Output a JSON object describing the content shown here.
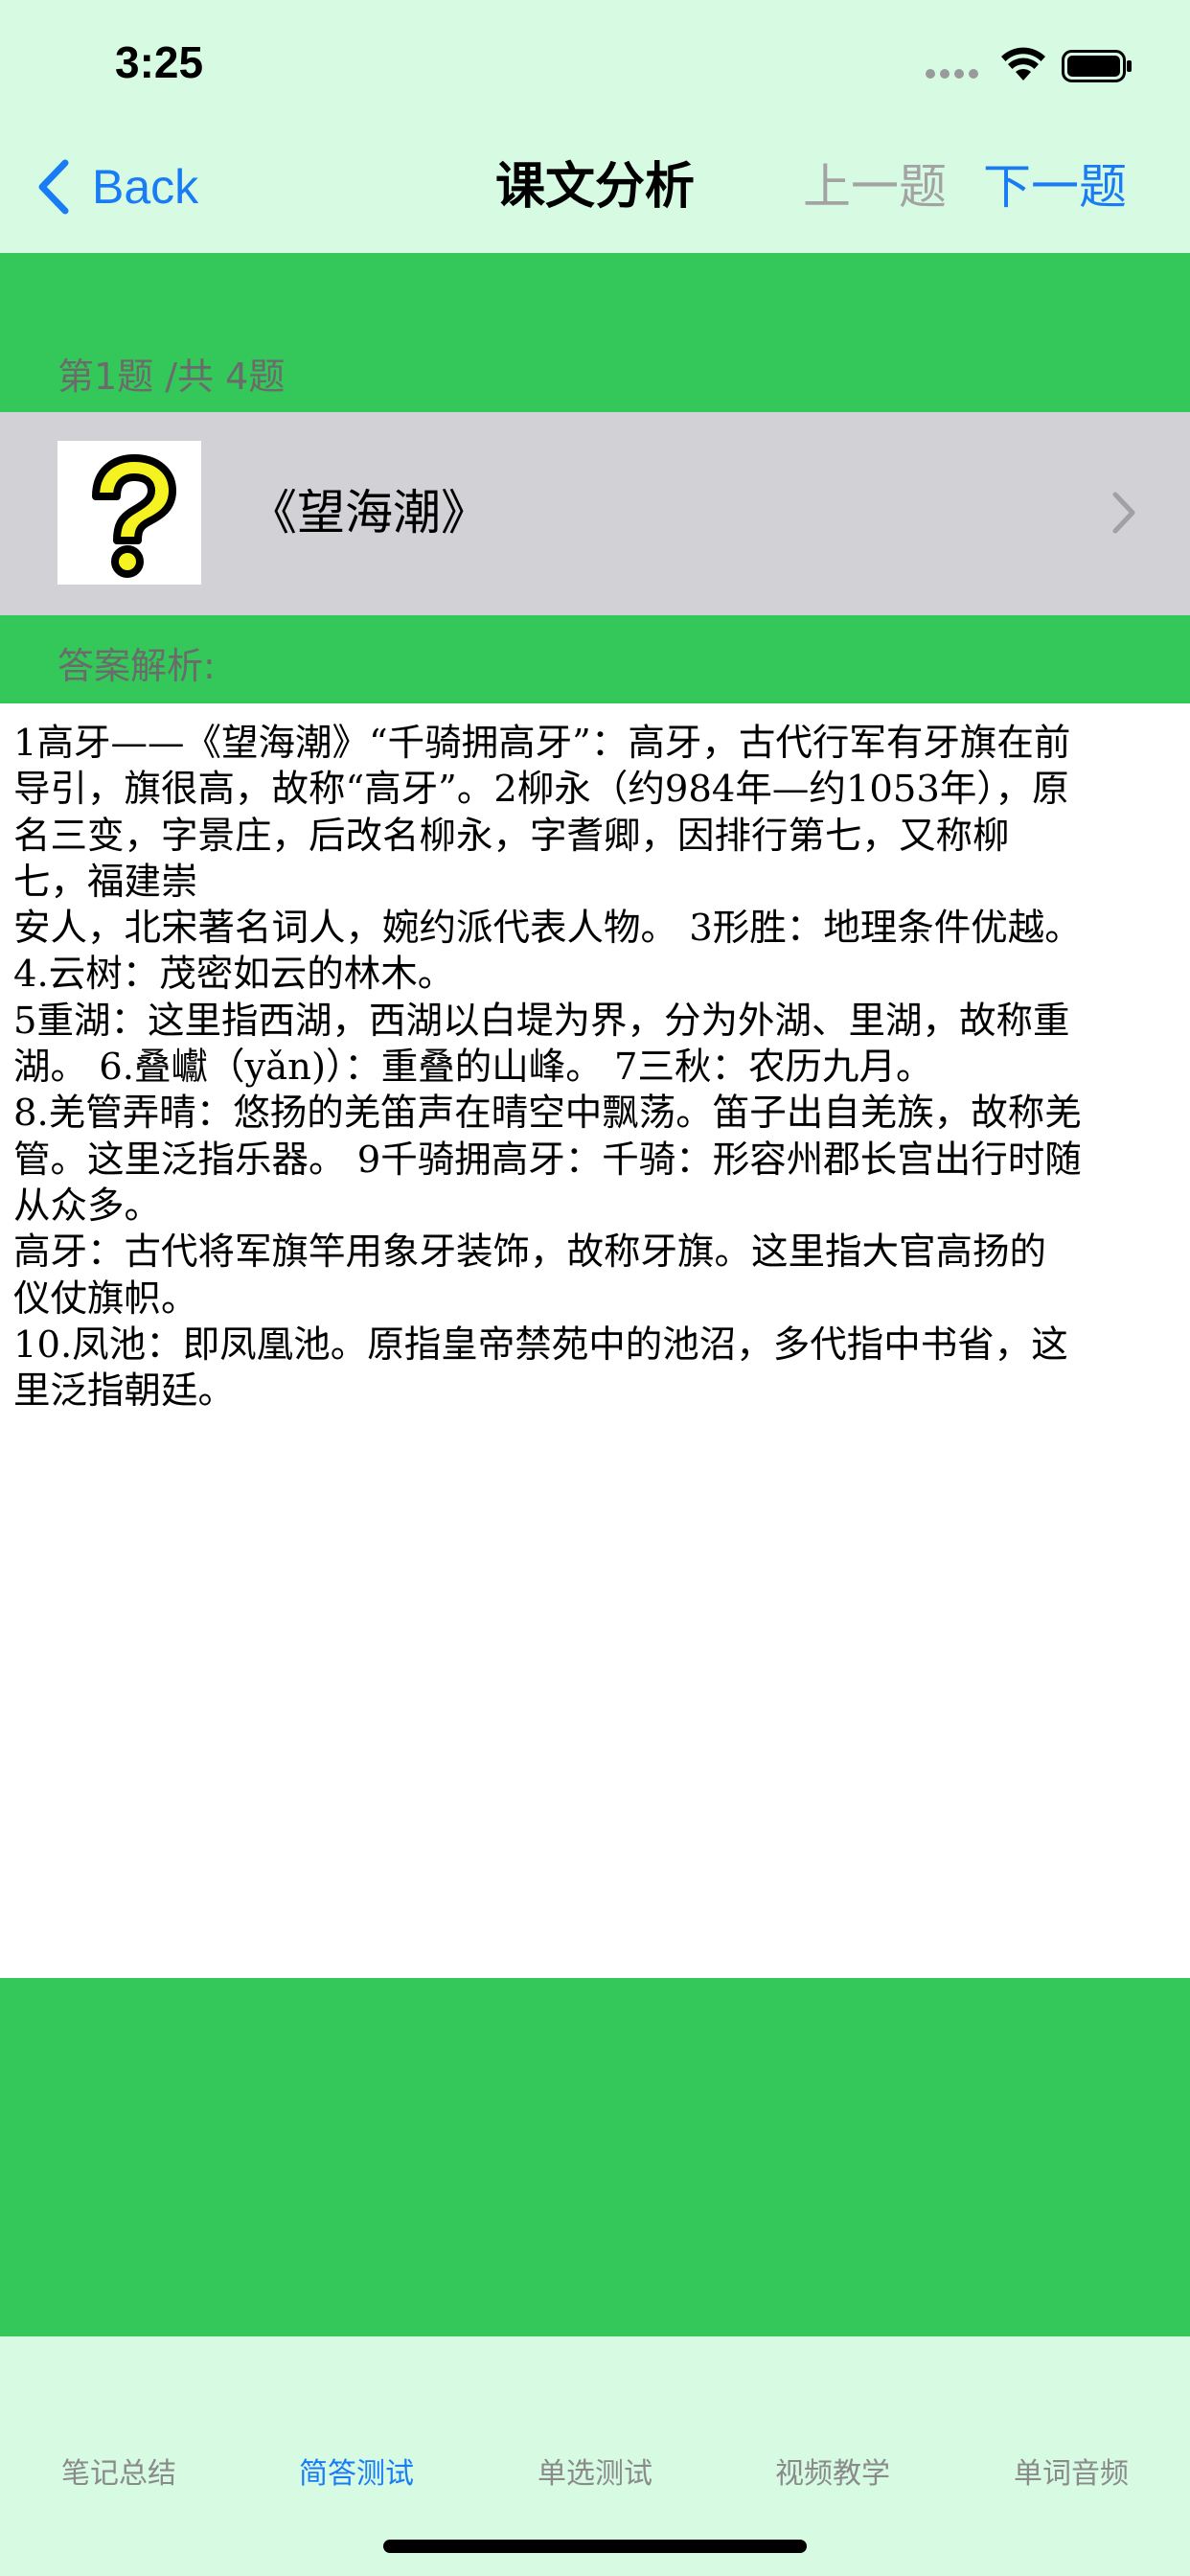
{
  "status_bar": {
    "time": "3:25"
  },
  "nav": {
    "back_label": "Back",
    "title": "课文分析",
    "prev_label": "上一题",
    "next_label": "下一题"
  },
  "question": {
    "counter": "第1题 /共 4题",
    "title": "《望海潮》",
    "thumbnail_icon": "question-mark-icon"
  },
  "answer": {
    "label": "答案解析:",
    "lines": [
      "1高牙——《望海潮》“千骑拥高牙”：高牙，古代行军有牙旗在前",
      "导引，旗很高，故称“高牙”。2柳永（约984年—约1053年），原",
      "名三变，字景庄，后改名柳永，字耆卿，因排行第七，又称柳",
      "七，福建崇",
      "安人，北宋著名词人，婉约派代表人物。 3形胜：地理条件优越。",
      "4.云树：茂密如云的林木。",
      "5重湖：这里指西湖，西湖以白堤为界，分为外湖、里湖，故称重",
      "湖。 6.叠巘（yǎn)）：重叠的山峰。 7三秋：农历九月。",
      "8.羌管弄晴：悠扬的羌笛声在晴空中飘荡。笛子出自羌族，故称羌",
      "管。这里泛指乐器。 9千骑拥高牙：千骑：形容州郡长宫出行时随",
      "从众多。",
      "高牙：古代将军旗竿用象牙装饰，故称牙旗。这里指大官高扬的",
      "仪仗旗帜。",
      "10.凤池：即凤凰池。原指皇帝禁苑中的池沼，多代指中书省，这",
      "里泛指朝廷。"
    ]
  },
  "tabs": [
    {
      "label": "笔记总结",
      "active": false
    },
    {
      "label": "简答测试",
      "active": true
    },
    {
      "label": "单选测试",
      "active": false
    },
    {
      "label": "视频教学",
      "active": false
    },
    {
      "label": "单词音频",
      "active": false
    }
  ],
  "colors": {
    "accent_blue": "#1a7cf5",
    "band_green": "#34c759",
    "header_mint": "#d6fbe2",
    "row_grey": "#d1d1d6",
    "disabled_grey": "#a3a3a3"
  }
}
